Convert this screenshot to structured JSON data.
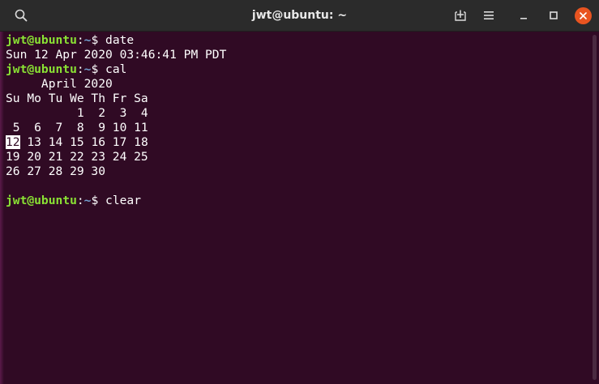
{
  "window": {
    "title": "jwt@ubuntu: ~"
  },
  "prompt": {
    "user_host": "jwt@ubuntu",
    "colon": ":",
    "path": "~",
    "symbol": "$ "
  },
  "session": [
    {
      "type": "command",
      "command": "date"
    },
    {
      "type": "output",
      "text": "Sun 12 Apr 2020 03:46:41 PM PDT"
    },
    {
      "type": "command",
      "command": "cal"
    },
    {
      "type": "output",
      "text": "     April 2020"
    },
    {
      "type": "output",
      "text": "Su Mo Tu We Th Fr Sa"
    },
    {
      "type": "output",
      "text": "          1  2  3  4"
    },
    {
      "type": "output",
      "text": " 5  6  7  8  9 10 11"
    },
    {
      "type": "highlight_line",
      "highlight": "12",
      "rest": " 13 14 15 16 17 18"
    },
    {
      "type": "output",
      "text": "19 20 21 22 23 24 25"
    },
    {
      "type": "output",
      "text": "26 27 28 29 30"
    },
    {
      "type": "output",
      "text": ""
    },
    {
      "type": "command",
      "command": "clear"
    }
  ],
  "icons": {
    "search": "search-icon",
    "new_tab": "new-tab-icon",
    "menu": "hamburger-menu-icon",
    "minimize": "minimize-icon",
    "maximize": "maximize-icon",
    "close": "close-icon"
  },
  "colors": {
    "background": "#300a24",
    "titlebar": "#2b2b2b",
    "prompt_user": "#8ae234",
    "prompt_path": "#729fcf",
    "close_button": "#e95420"
  }
}
